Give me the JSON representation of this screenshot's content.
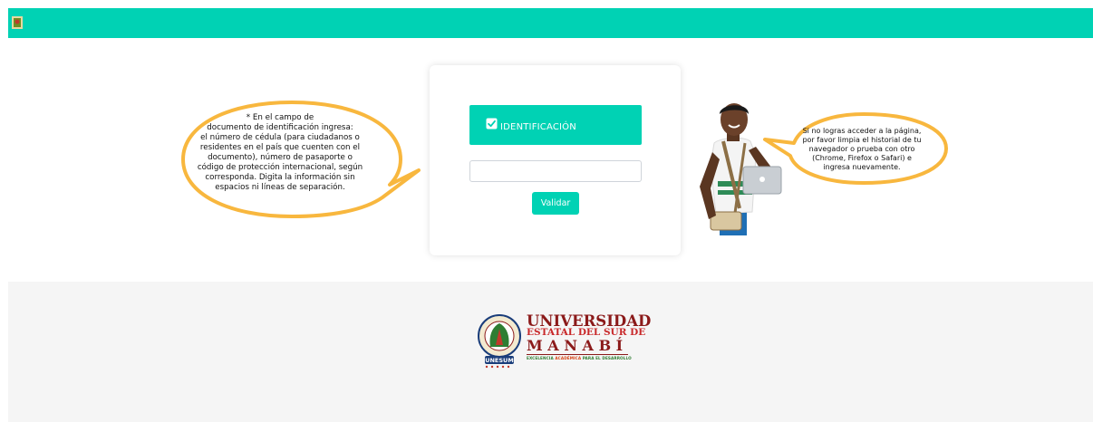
{
  "colors": {
    "accent": "#00d2b4",
    "bubble_border": "#f8b73e",
    "university_red": "#8b1a1a"
  },
  "header": {
    "logo_icon": "university-seal-icon"
  },
  "info_left": {
    "text": "* En el campo de\ndocumento de identificación ingresa:\nel número de cédula (para ciudadanos o\nresidentes en el país que cuenten con el\ndocumento), número de pasaporte o\ncódigo de protección internacional, según\ncorresponda. Digita la información sin\nespacios ni líneas de separación."
  },
  "form": {
    "header_icon": "checkbox-icon",
    "header_label": "IDENTIFICACIÓN",
    "input_value": "",
    "input_placeholder": "",
    "submit_label": "Validar"
  },
  "info_right": {
    "text": "Si no logras acceder a la página,\npor favor limpia el historial de tu\nnavegador o prueba con otro\n(Chrome, Firefox o Safari) e\ningresa nuevamente."
  },
  "footer": {
    "logo": {
      "name": "UNIVERSIDAD",
      "subtitle": "ESTATAL DEL SUR DE",
      "location": "MANABÍ",
      "tagline_part1": "EXCELENCIA ",
      "tagline_part2": "ACADÉMICA",
      "tagline_part3": " PARA EL DESARROLLO",
      "seal_text": "UNIVERSIDAD ESTATAL DEL SUR DE MANABÍ",
      "seal_acronym": "UNESUM"
    }
  }
}
